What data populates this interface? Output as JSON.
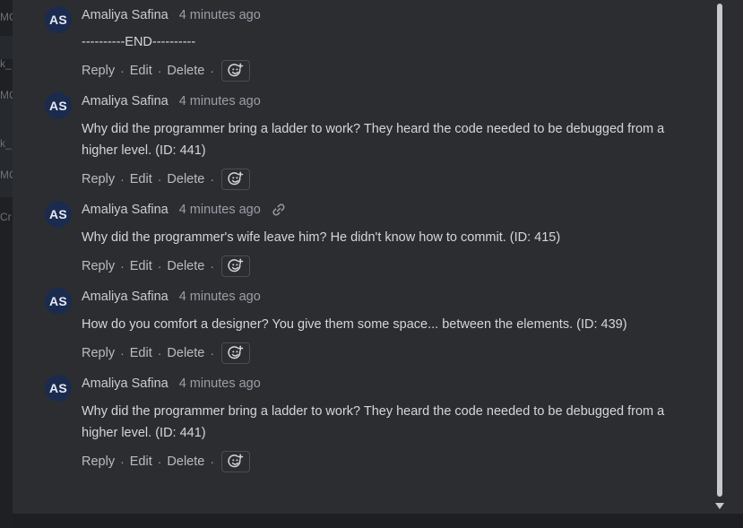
{
  "background_fragments": [
    "MC",
    "k_",
    "MC",
    "k_",
    "MC",
    "Cr"
  ],
  "actions": {
    "reply": "Reply",
    "edit": "Edit",
    "delete": "Delete",
    "separator": "·"
  },
  "comments": [
    {
      "initials": "AS",
      "author": "Amaliya Safina",
      "time": "4 minutes ago",
      "lines": [
        "----------END----------"
      ],
      "has_link_icon": false
    },
    {
      "initials": "AS",
      "author": "Amaliya Safina",
      "time": "4 minutes ago",
      "lines": [
        "Why did the programmer bring a ladder to work? They heard the code needed to be debugged from a",
        "higher level. (ID: 441)"
      ],
      "has_link_icon": false
    },
    {
      "initials": "AS",
      "author": "Amaliya Safina",
      "time": "4 minutes ago",
      "lines": [
        "Why did the programmer's wife leave him? He didn't know how to commit. (ID: 415)"
      ],
      "has_link_icon": true
    },
    {
      "initials": "AS",
      "author": "Amaliya Safina",
      "time": "4 minutes ago",
      "lines": [
        "How do you comfort a designer? You give them some space... between the elements. (ID: 439)"
      ],
      "has_link_icon": false
    },
    {
      "initials": "AS",
      "author": "Amaliya Safina",
      "time": "4 minutes ago",
      "lines": [
        "Why did the programmer bring a ladder to work? They heard the code needed to be debugged from a",
        "higher level. (ID: 441)"
      ],
      "has_link_icon": false
    }
  ],
  "colors": {
    "panel": "#2b2d31",
    "avatar": "#1b2b4e",
    "page": "#1e1f22"
  }
}
